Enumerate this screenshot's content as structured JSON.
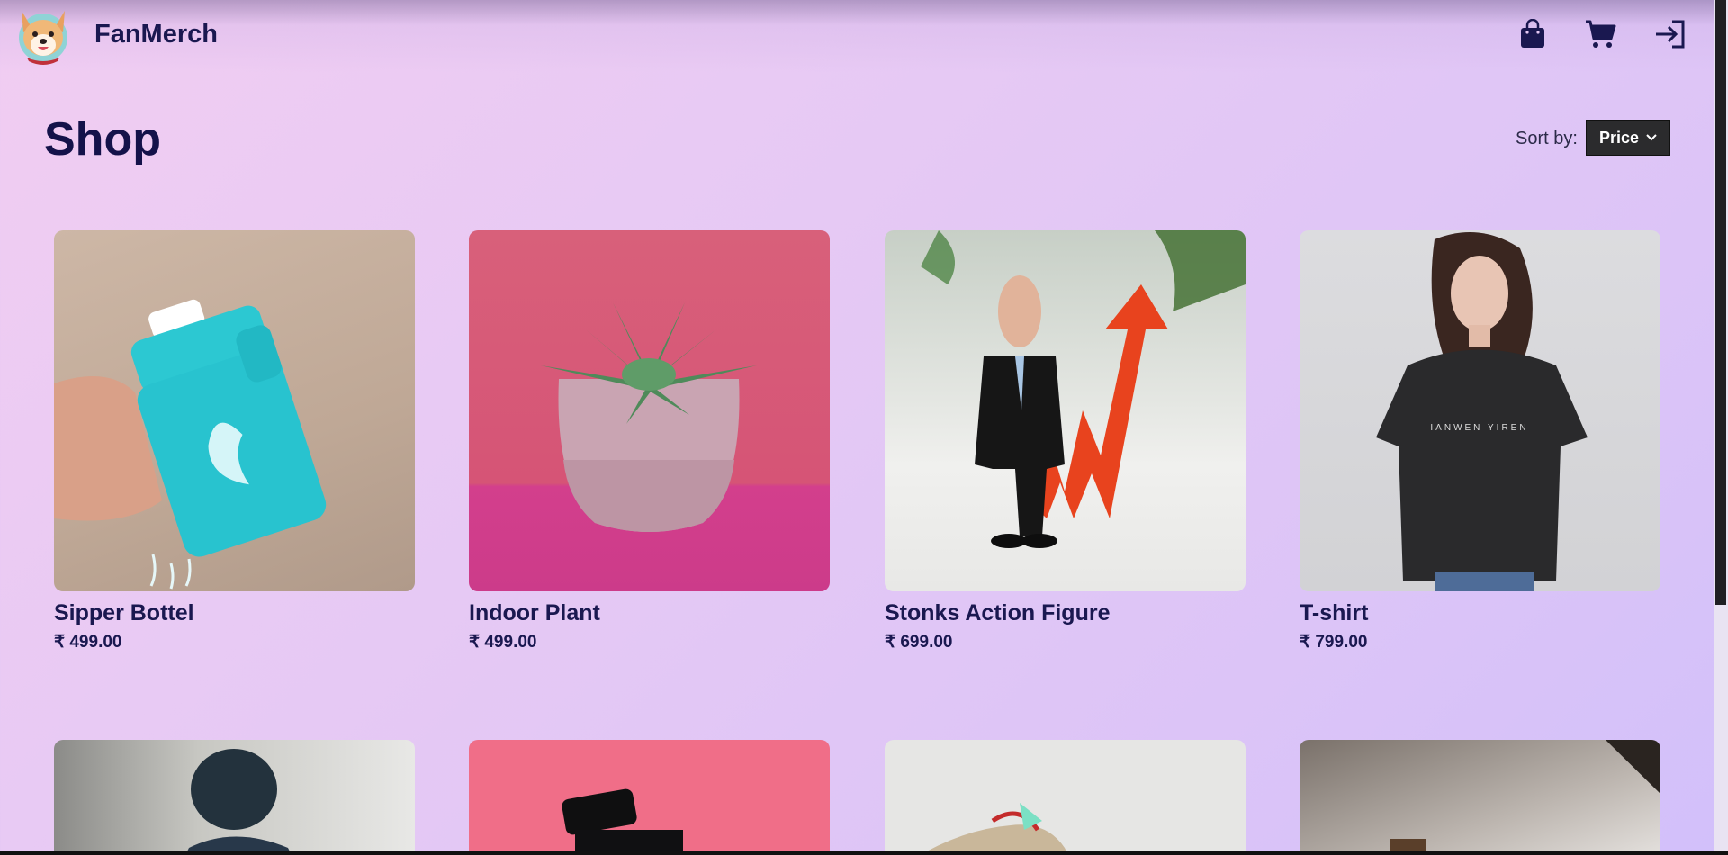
{
  "header": {
    "brand": "FanMerch",
    "logo_icon": "dog-logo-icon",
    "icons": [
      "shopping-bag-icon",
      "cart-icon",
      "login-icon"
    ]
  },
  "main": {
    "title": "Shop",
    "sort_label": "Sort by:",
    "sort_value": "Price"
  },
  "products": [
    {
      "name": "Sipper Bottel",
      "price": "₹ 499.00",
      "image": "sipper-bottle-image"
    },
    {
      "name": "Indoor Plant",
      "price": "₹ 499.00",
      "image": "indoor-plant-image"
    },
    {
      "name": "Stonks Action Figure",
      "price": "₹ 699.00",
      "image": "stonks-figure-image"
    },
    {
      "name": "T-shirt",
      "price": "₹ 799.00",
      "image": "tshirt-image"
    }
  ],
  "products_row2": [
    {
      "image": "beanie-person-image"
    },
    {
      "image": "perfume-image"
    },
    {
      "image": "sneakers-image"
    },
    {
      "image": "product-image"
    }
  ],
  "colors": {
    "text_dark": "#14124a",
    "select_bg": "#2b2b2d"
  }
}
